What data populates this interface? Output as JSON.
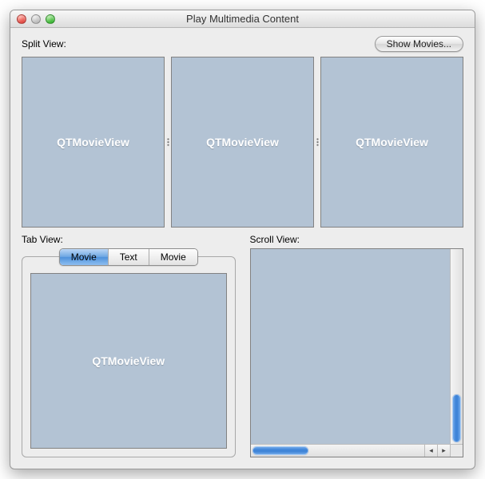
{
  "window": {
    "title": "Play Multimedia Content"
  },
  "labels": {
    "split_view": "Split View:",
    "tab_view": "Tab View:",
    "scroll_view": "Scroll View:"
  },
  "buttons": {
    "show_movies": "Show Movies..."
  },
  "split_panes": [
    {
      "placeholder": "QTMovieView"
    },
    {
      "placeholder": "QTMovieView"
    },
    {
      "placeholder": "QTMovieView"
    }
  ],
  "tabs": [
    {
      "label": "Movie",
      "selected": true
    },
    {
      "label": "Text",
      "selected": false
    },
    {
      "label": "Movie",
      "selected": false
    }
  ],
  "tab_content": {
    "placeholder": "QTMovieView"
  }
}
